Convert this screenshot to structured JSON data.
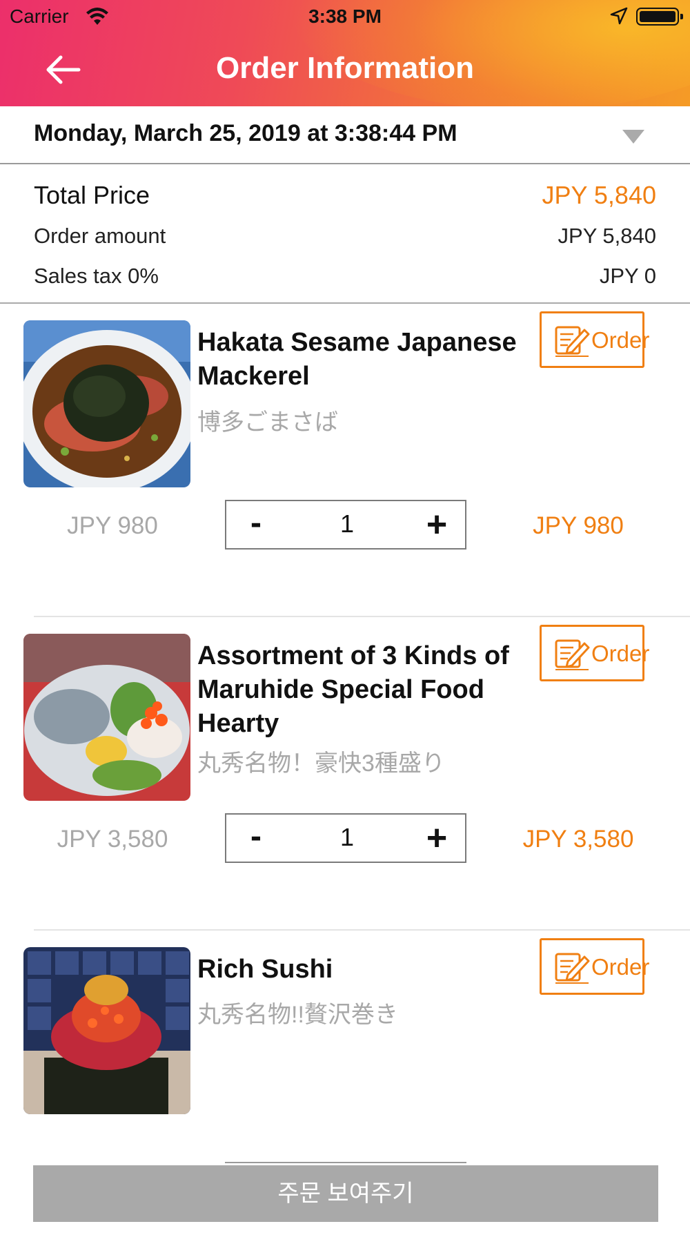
{
  "status_bar": {
    "carrier": "Carrier",
    "time": "3:38 PM"
  },
  "header": {
    "title": "Order Information",
    "back_icon": "back-arrow-icon",
    "gradient_colors": [
      "#ec2f6b",
      "#f2733a",
      "#f59b26"
    ]
  },
  "date_selector": {
    "value": "Monday, March 25, 2019 at 3:38:44 PM",
    "icon": "dropdown-caret-icon"
  },
  "totals": {
    "total_price_label": "Total Price",
    "total_price_value": "JPY 5,840",
    "order_amount_label": "Order amount",
    "order_amount_value": "JPY 5,840",
    "sales_tax_label": "Sales tax 0%",
    "sales_tax_value": "JPY 0"
  },
  "accent_color": "#f07f12",
  "items": [
    {
      "name": "Hakata Sesame Japanese Mackerel",
      "name_jp": "博多ごまさば",
      "unit_price": "JPY 980",
      "quantity": "1",
      "line_total": "JPY 980",
      "order_label": "Order"
    },
    {
      "name": "Assortment of 3 Kinds of Maruhide Special Food Hearty",
      "name_jp": "丸秀名物！豪快3種盛り",
      "unit_price": "JPY 3,580",
      "quantity": "1",
      "line_total": "JPY 3,580",
      "order_label": "Order"
    },
    {
      "name": "Rich Sushi",
      "name_jp": "丸秀名物!!贅沢巻き",
      "order_label": "Order"
    }
  ],
  "stepper": {
    "minus": "-",
    "plus": "+"
  },
  "bottom_button": {
    "label": "주문 보여주기"
  }
}
